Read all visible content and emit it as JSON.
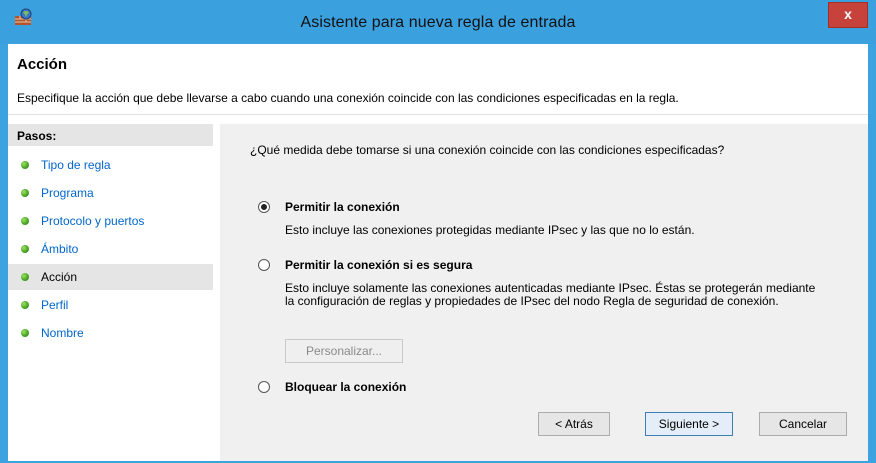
{
  "window": {
    "title": "Asistente para nueva regla de entrada",
    "close_label": "x"
  },
  "header": {
    "title": "Acción",
    "description": "Especifique la acción que debe llevarse a cabo cuando una conexión coincide con las condiciones especificadas en la regla."
  },
  "steps": {
    "title": "Pasos:",
    "items": [
      {
        "label": "Tipo de regla"
      },
      {
        "label": "Programa"
      },
      {
        "label": "Protocolo y puertos"
      },
      {
        "label": "Ámbito"
      },
      {
        "label": "Acción"
      },
      {
        "label": "Perfil"
      },
      {
        "label": "Nombre"
      }
    ],
    "current_index": 4
  },
  "content": {
    "question": "¿Qué medida debe tomarse si una conexión coincide con las condiciones especificadas?",
    "options": [
      {
        "label": "Permitir la conexión",
        "description": "Esto incluye las conexiones protegidas mediante IPsec y las que no lo están.",
        "selected": true
      },
      {
        "label": "Permitir la conexión si es segura",
        "description": "Esto incluye solamente las conexiones autenticadas mediante IPsec. Éstas se protegerán mediante la configuración de reglas y propiedades de IPsec del nodo Regla de seguridad de conexión.",
        "selected": false
      },
      {
        "label": "Bloquear la conexión",
        "description": "",
        "selected": false
      }
    ],
    "customize_label": "Personalizar..."
  },
  "buttons": {
    "back": "< Atrás",
    "next": "Siguiente >",
    "cancel": "Cancelar"
  },
  "icons": {
    "app": "firewall-icon",
    "step_status": "green-dot-icon"
  }
}
